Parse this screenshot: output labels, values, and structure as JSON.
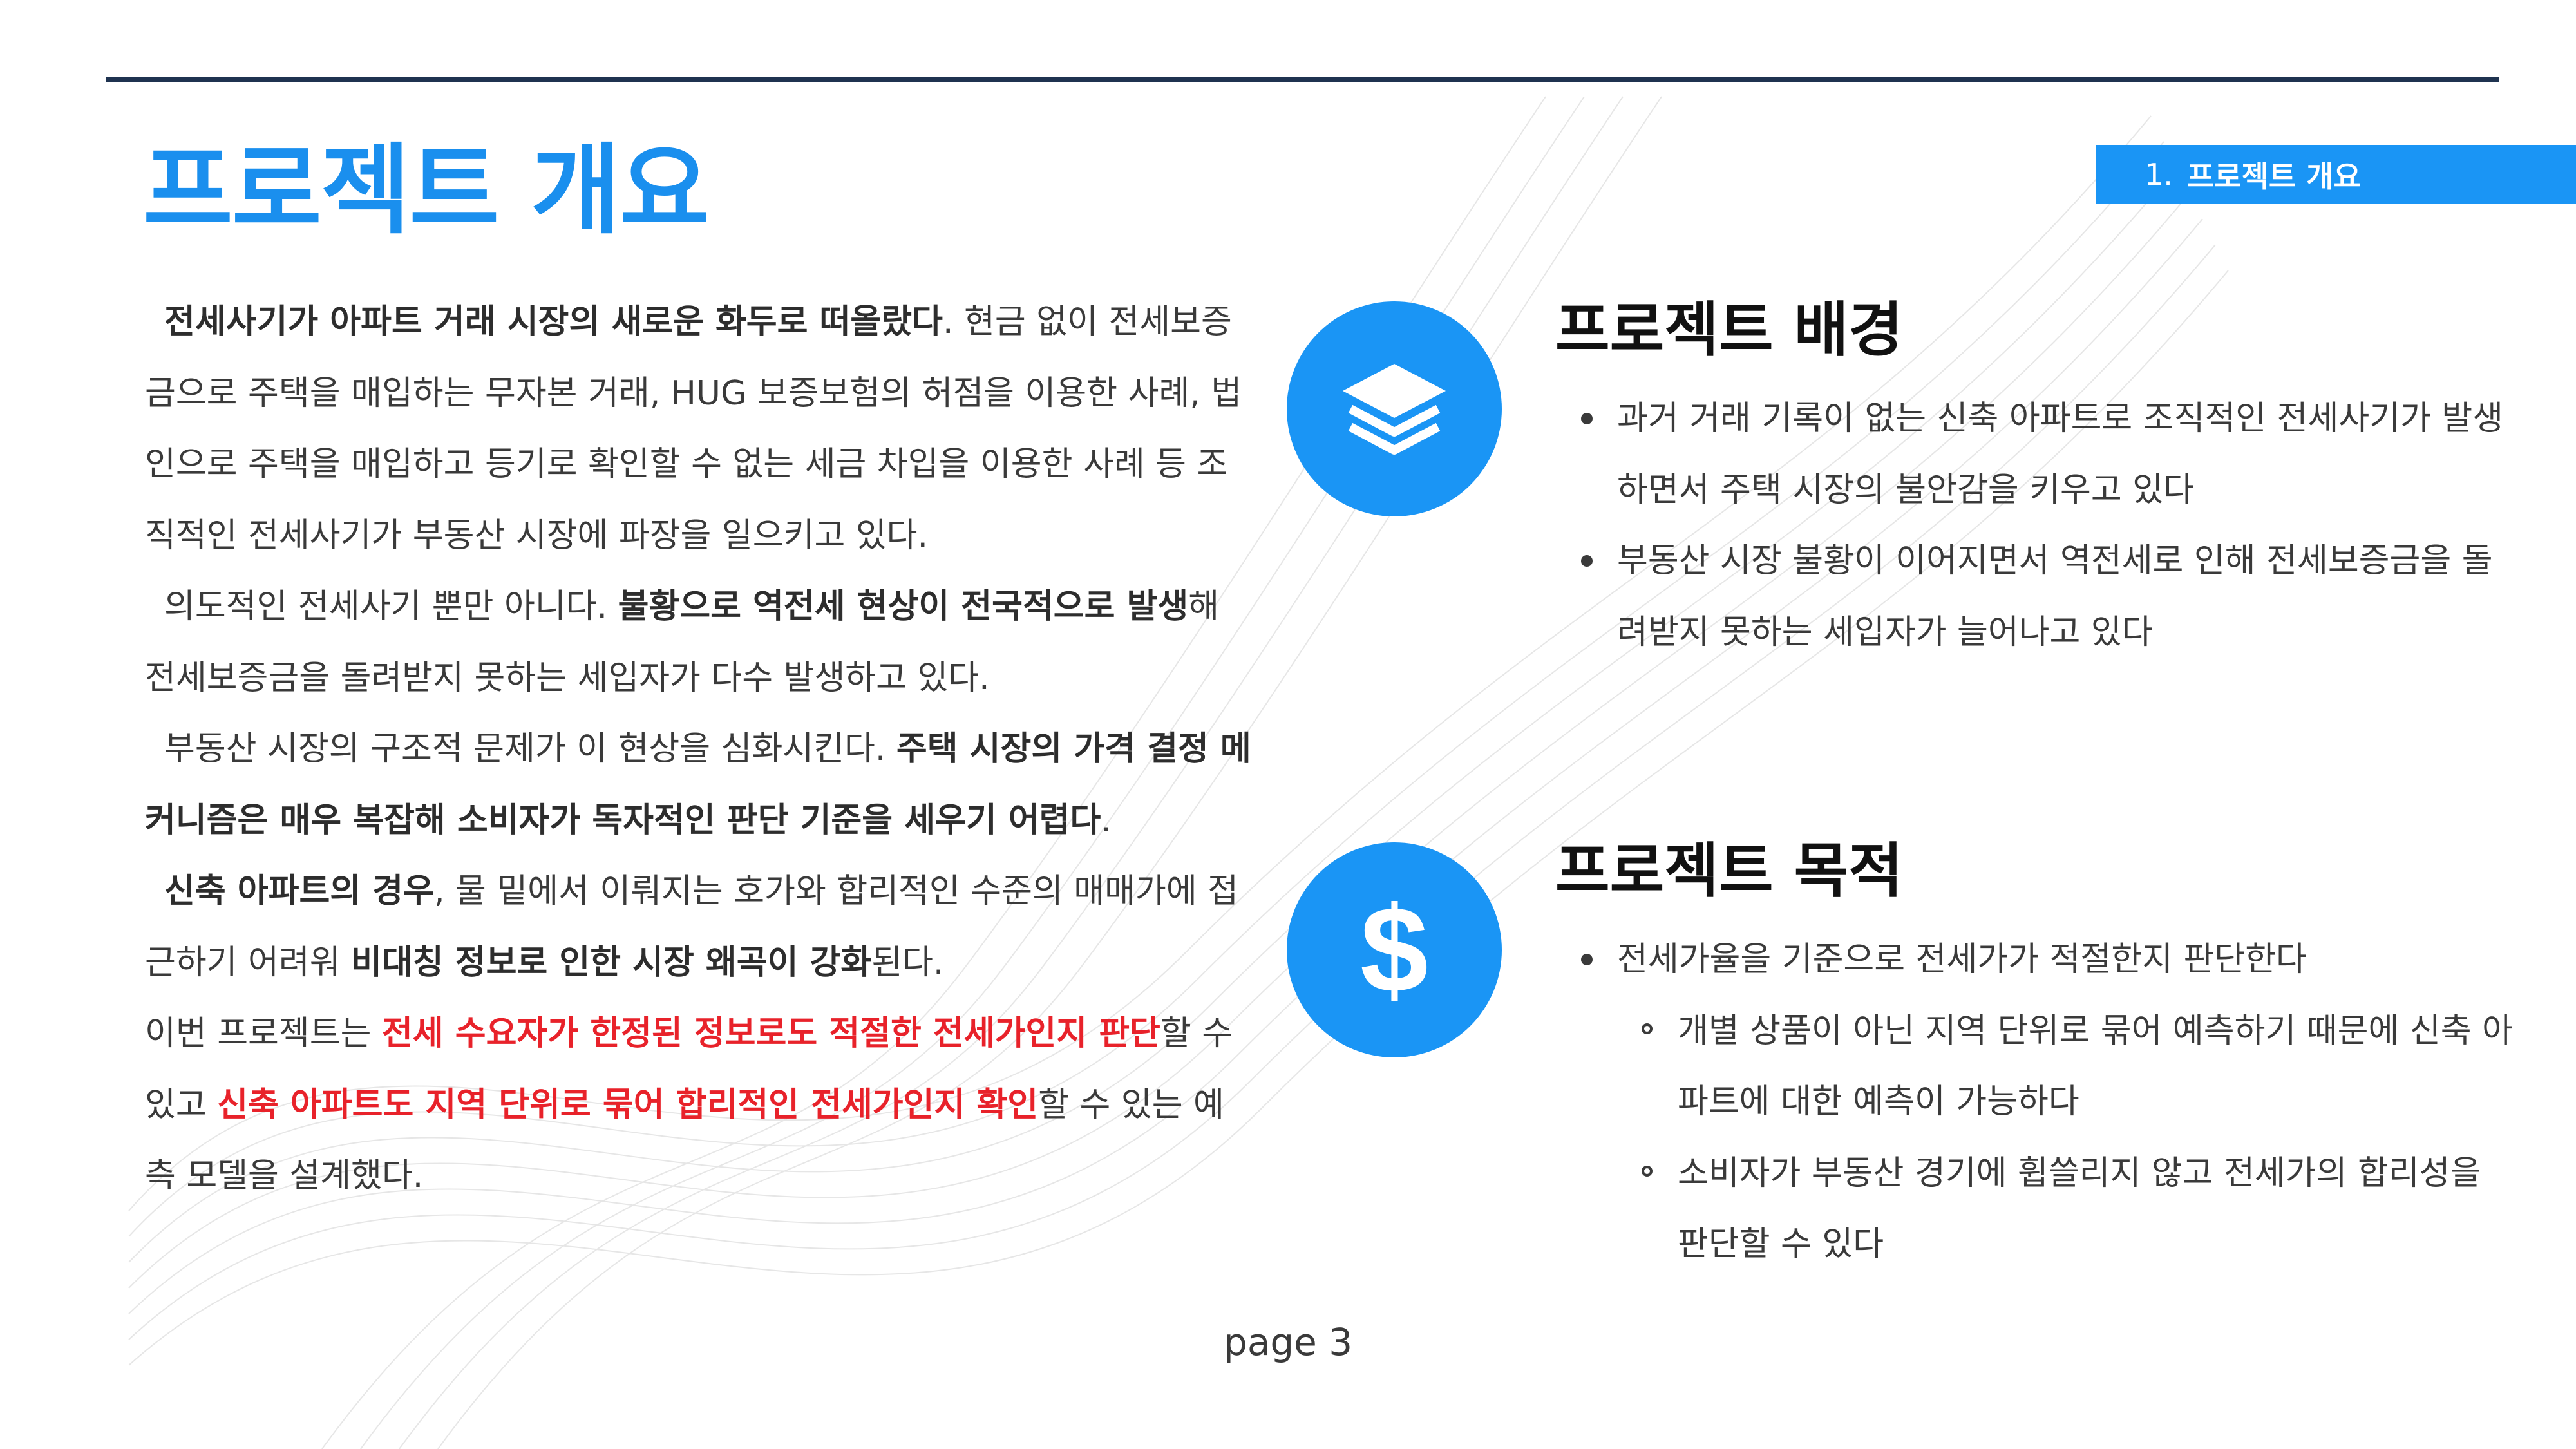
{
  "page_title": "프로젝트 개요",
  "section_tag": {
    "number": "1.",
    "label": "프로젝트 개요"
  },
  "body": {
    "p1": {
      "bold": "전세사기가 아파트 거래 시장의 새로운 화두로 떠올랐다",
      "text": ". 현금 없이 전세보증금으로 주택을 매입하는 무자본 거래, HUG 보증보험의 허점을 이용한 사례, 법인으로 주택을 매입하고 등기로 확인할 수 없는 세금 차입을 이용한 사례 등 조직적인 전세사기가 부동산 시장에 파장을 일으키고 있다."
    },
    "p2": {
      "text1": "의도적인 전세사기 뿐만 아니다. ",
      "bold": "불황으로 역전세 현상이 전국적으로 발생",
      "text2": "해 전세보증금을 돌려받지 못하는 세입자가 다수 발생하고 있다."
    },
    "p3": {
      "text1": "부동산 시장의 구조적 문제가 이 현상을 심화시킨다. ",
      "bold": "주택 시장의 가격 결정 메커니즘은 매우 복잡해 소비자가 독자적인 판단 기준을 세우기 어렵다",
      "text2": "."
    },
    "p4": {
      "bold1": "신축 아파트의 경우",
      "text1": ", 물 밑에서 이뤄지는 호가와 합리적인 수준의 매매가에 접근하기 어려워 ",
      "bold2": "비대칭 정보로 인한 시장 왜곡이 강화",
      "text2": "된다."
    },
    "p5": {
      "text1": "이번 프로젝트는 ",
      "red1": "전세 수요자가 한정된 정보로도 적절한 전세가인지 판단",
      "text2": "할 수 있고 ",
      "red2": "신축 아파트도 지역 단위로 묶어 합리적인 전세가인지 확인",
      "text3": "할 수 있는 예측 모델을 설계했다."
    }
  },
  "background": {
    "heading": "프로젝트 배경",
    "icon": "layers-icon",
    "bullets": [
      "과거 거래 기록이 없는 신축 아파트로 조직적인 전세사기가 발생하면서 주택 시장의 불안감을 키우고 있다",
      "부동산 시장 불황이 이어지면서 역전세로 인해 전세보증금을 돌려받지 못하는 세입자가 늘어나고 있다"
    ]
  },
  "goal": {
    "heading": "프로젝트 목적",
    "icon": "dollar-icon",
    "bullet": "전세가율을 기준으로 전세가가 적절한지 판단한다",
    "sub_bullets": [
      "개별 상품이 아닌 지역 단위로 묶어 예측하기 때문에 신축 아파트에 대한 예측이 가능하다",
      "소비자가 부동산 경기에 휩쓸리지 않고 전세가의 합리성을 판단할 수 있다"
    ]
  },
  "footer": {
    "page": "page 3"
  },
  "colors": {
    "accent": "#1a95f5",
    "title": "#1a8fee",
    "highlight_red": "#e8222a",
    "rule": "#1f3350"
  }
}
